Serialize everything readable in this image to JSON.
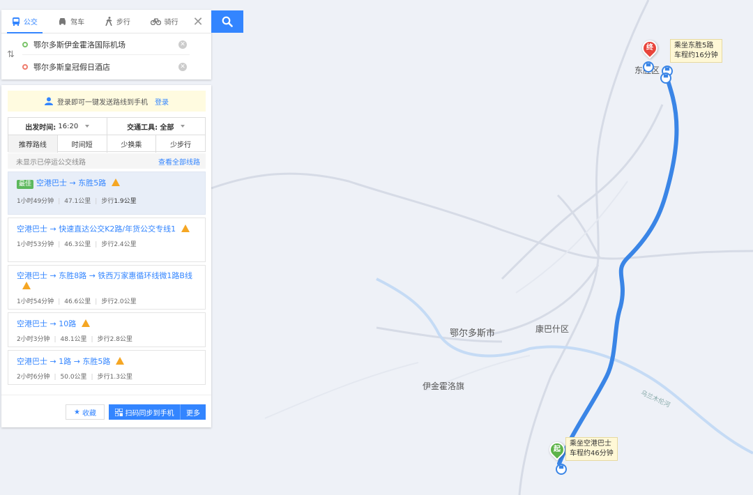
{
  "modes": [
    {
      "label": "公交",
      "icon": "bus-icon",
      "active": true
    },
    {
      "label": "驾车",
      "icon": "car-icon",
      "active": false
    },
    {
      "label": "步行",
      "icon": "walk-icon",
      "active": false
    },
    {
      "label": "骑行",
      "icon": "bike-icon",
      "active": false
    }
  ],
  "origin": "鄂尔多斯伊金霍洛国际机场",
  "destination": "鄂尔多斯皇冠假日酒店",
  "login_tip": {
    "text": "登录即可一键发送路线到手机",
    "link": "登录"
  },
  "options": {
    "depart_label": "出发时间:",
    "depart_value": "16:20",
    "vehicle_label": "交通工具:",
    "vehicle_value": "全部",
    "tabs": [
      "推荐路线",
      "时间短",
      "少换乘",
      "少步行"
    ]
  },
  "notice": {
    "text": "未显示已停运公交线路",
    "link": "查看全部线路"
  },
  "routes": [
    {
      "best": "最佳",
      "title": "空港巴士 → 东胜5路",
      "duration": "1小时49分钟",
      "distance": "47.1公里",
      "walk_label": "步行",
      "walk": "1.9公里"
    },
    {
      "best": "",
      "title": "空港巴士 → 快速直达公交K2路/年货公交专线1",
      "duration": "1小时53分钟",
      "distance": "46.3公里",
      "walk_label": "步行",
      "walk": "2.4公里"
    },
    {
      "best": "",
      "title": "空港巴士 → 东胜8路 → 铁西万家惠循环线微1路B线",
      "duration": "1小时54分钟",
      "distance": "46.6公里",
      "walk_label": "步行",
      "walk": "2.0公里"
    },
    {
      "best": "",
      "title": "空港巴士 → 10路",
      "duration": "2小时3分钟",
      "distance": "48.1公里",
      "walk_label": "步行",
      "walk": "2.8公里"
    },
    {
      "best": "",
      "title": "空港巴士 → 1路 → 东胜5路",
      "duration": "2小时6分钟",
      "distance": "50.0公里",
      "walk_label": "步行",
      "walk": "1.3公里"
    }
  ],
  "footer": {
    "fav": "收藏",
    "qr": "扫码同步到手机",
    "more": "更多"
  },
  "map": {
    "labels": {
      "city": "鄂尔多斯市",
      "district": "康巴什区",
      "county": "伊金霍洛旗",
      "river": "乌兰木伦河",
      "dongsheng": "东胜区"
    },
    "start_pin": "起",
    "end_pin": "终",
    "start_callout": {
      "line1": "乘坐空港巴士",
      "line2": "车程约46分钟"
    },
    "end_callout": {
      "line1": "乘坐东胜5路",
      "line2": "车程约16分钟"
    },
    "route_color": "#3a85e6"
  }
}
